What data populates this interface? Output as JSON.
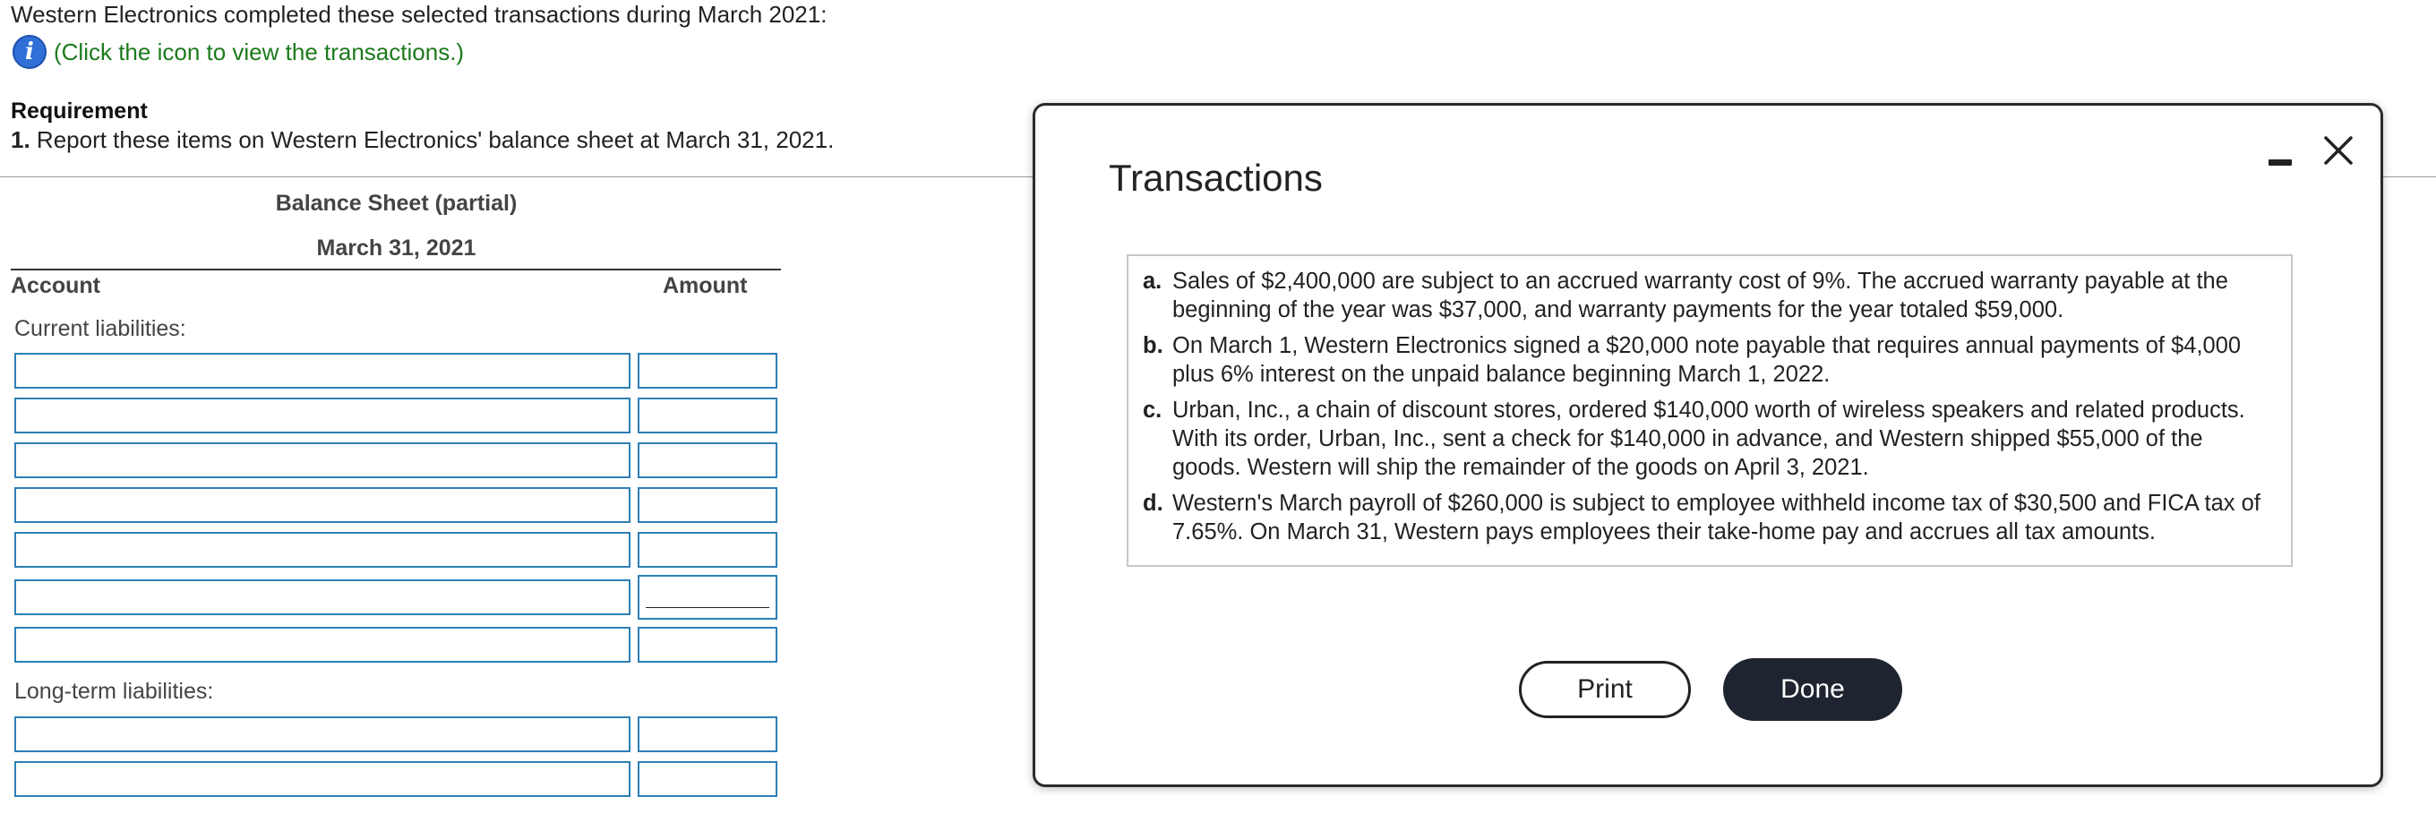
{
  "intro": {
    "text": "Western Electronics completed these selected transactions during March 2021:",
    "info_link": "(Click the icon to view the transactions.)"
  },
  "requirement": {
    "heading": "Requirement",
    "number": "1.",
    "text": "Report these items on Western Electronics' balance sheet at March 31, 2021."
  },
  "balance_sheet": {
    "title": "Balance Sheet (partial)",
    "date": "March 31, 2021",
    "columns": {
      "account": "Account",
      "amount": "Amount"
    },
    "current_label": "Current liabilities:",
    "longterm_label": "Long-term liabilities:",
    "current_rows": [
      {
        "account": "",
        "amount": ""
      },
      {
        "account": "",
        "amount": ""
      },
      {
        "account": "",
        "amount": ""
      },
      {
        "account": "",
        "amount": ""
      },
      {
        "account": "",
        "amount": ""
      },
      {
        "account": "",
        "amount": ""
      },
      {
        "account": "",
        "amount": ""
      }
    ],
    "longterm_rows": [
      {
        "account": "",
        "amount": ""
      },
      {
        "account": "",
        "amount": ""
      }
    ]
  },
  "modal": {
    "title": "Transactions",
    "items": [
      {
        "letter": "a.",
        "text": "Sales of $2,400,000 are subject to an accrued warranty cost of 9%. The accrued warranty payable at the beginning of the year was $37,000, and warranty payments for the year totaled $59,000."
      },
      {
        "letter": "b.",
        "text": "On March 1, Western Electronics signed a $20,000 note payable that requires annual payments of $4,000 plus 6% interest on the unpaid balance beginning March 1, 2022."
      },
      {
        "letter": "c.",
        "text": "Urban, Inc., a chain of discount stores, ordered $140,000 worth of wireless speakers and related products. With its order, Urban, Inc., sent a check for $140,000 in advance, and Western shipped $55,000 of the goods. Western will ship the remainder of the goods on April 3, 2021."
      },
      {
        "letter": "d.",
        "text": "Western's March payroll of $260,000 is subject to employee withheld income tax of $30,500 and FICA tax of 7.65%. On March 31, Western pays employees their take-home pay and accrues all tax amounts."
      }
    ],
    "print_label": "Print",
    "done_label": "Done"
  },
  "colors": {
    "link": "#1c7a1c",
    "info_icon": "#2f6fd6",
    "input_border": "#2d7fb5",
    "done_button": "#1e2530"
  }
}
